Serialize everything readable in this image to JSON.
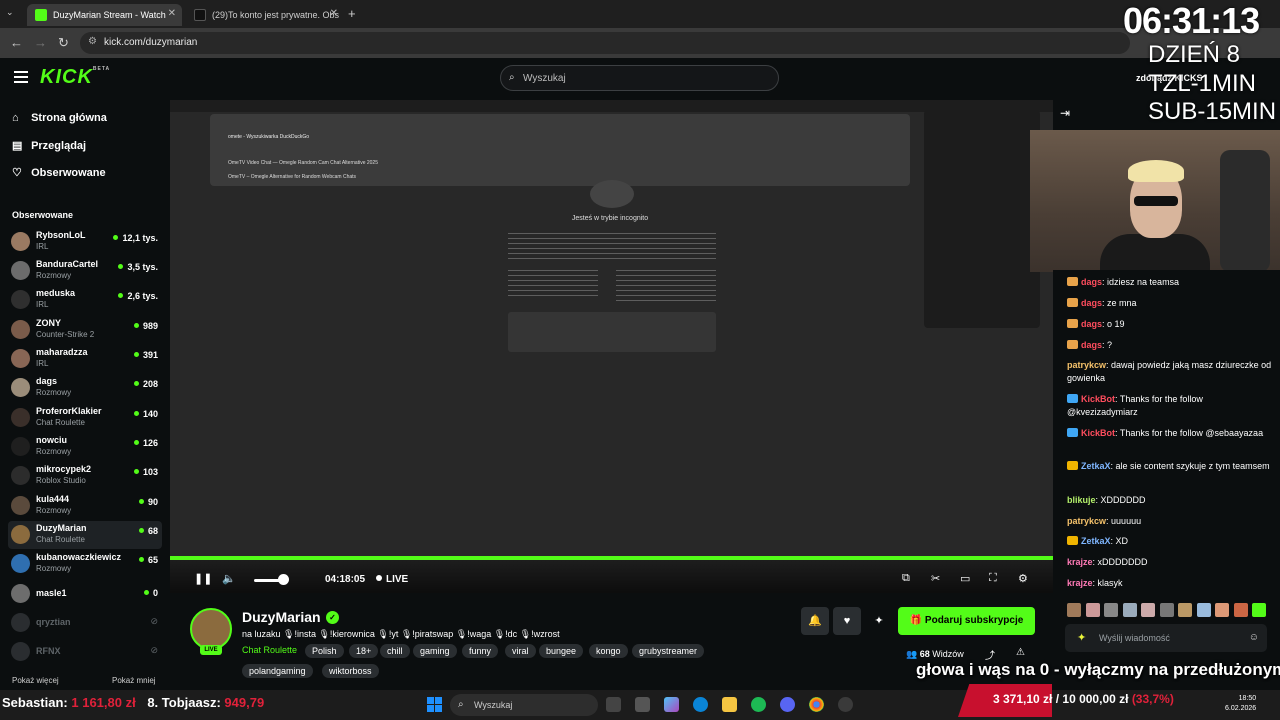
{
  "browser": {
    "tabs": [
      {
        "label": "DuzyMarian Stream - Watch",
        "active": true
      },
      {
        "label": "(29)To konto jest prywatne. Obs",
        "active": false
      }
    ],
    "url": "kick.com/duzymarian"
  },
  "header": {
    "search_placeholder": "Wyszukaj"
  },
  "sidebar": {
    "nav": [
      {
        "label": "Strona główna",
        "icon": "home-icon"
      },
      {
        "label": "Przeglądaj",
        "icon": "browse-icon"
      },
      {
        "label": "Obserwowane",
        "icon": "heart-icon"
      }
    ],
    "followed_title": "Obserwowane",
    "channels": [
      {
        "name": "RybsonLoL",
        "category": "IRL",
        "viewers": "12,1 tys."
      },
      {
        "name": "BanduraCartel",
        "category": "Rozmowy",
        "viewers": "3,5 tys."
      },
      {
        "name": "meduska",
        "category": "IRL",
        "viewers": "2,6 tys."
      },
      {
        "name": "ZONY",
        "category": "Counter-Strike 2",
        "viewers": "989"
      },
      {
        "name": "maharadzza",
        "category": "IRL",
        "viewers": "391"
      },
      {
        "name": "dags",
        "category": "Rozmowy",
        "viewers": "208"
      },
      {
        "name": "ProferorKlakier",
        "category": "Chat Roulette",
        "viewers": "140"
      },
      {
        "name": "nowciu",
        "category": "Rozmowy",
        "viewers": "126"
      },
      {
        "name": "mikrocypek2",
        "category": "Roblox Studio",
        "viewers": "103"
      },
      {
        "name": "kula444",
        "category": "Rozmowy",
        "viewers": "90"
      },
      {
        "name": "DuzyMarian",
        "category": "Chat Roulette",
        "viewers": "68"
      },
      {
        "name": "kubanowaczkiewicz",
        "category": "Rozmowy",
        "viewers": "65"
      },
      {
        "name": "masle1",
        "category": "",
        "viewers": "0"
      },
      {
        "name": "qryztian",
        "category": "",
        "viewers": ""
      },
      {
        "name": "RFNX",
        "category": "",
        "viewers": ""
      }
    ],
    "show_more": "Pokaż więcej",
    "show_less": "Pokaż mniej"
  },
  "player": {
    "time": "04:18:05",
    "live_label": "LIVE",
    "volume_fraction": 0.75,
    "inner_screen": {
      "incognito_title": "Jesteś w trybie incognito",
      "dropdown_items": [
        "omete - Wyszukiwarka DuckDuckGo",
        "OmeTV Video Chat — Omegle Random Cam Chat Alternative 2025",
        "OmeTV – Omegle Alternative for Random Webcam Chats"
      ]
    }
  },
  "overlay": {
    "clock": "06:31:13",
    "day": "DZIEŃ 8",
    "tzl": "TZL-1MIN",
    "sub": "SUB-15MIN",
    "kick_label": "zdobądź KICKS"
  },
  "chat": {
    "messages": [
      {
        "user": "dags",
        "text": "idziesz na teamsa",
        "color": "#ff4d5e",
        "badge": "#e8a34a"
      },
      {
        "user": "dags",
        "text": "ze mna",
        "color": "#ff4d5e",
        "badge": "#e8a34a"
      },
      {
        "user": "dags",
        "text": "o 19",
        "color": "#ff4d5e",
        "badge": "#e8a34a"
      },
      {
        "user": "dags",
        "text": "?",
        "color": "#ff4d5e",
        "badge": "#e8a34a"
      },
      {
        "user": "patrykcw",
        "text": "dawaj powiedz jaką masz dziureczke od gowienka",
        "color": "#f5c26b",
        "badge": ""
      },
      {
        "user": "KickBot",
        "text": "Thanks for the follow @kvezizadymiarz",
        "color": "#ff4d5e",
        "badge": "#3fa7f5"
      },
      {
        "user": "KickBot",
        "text": "Thanks for the follow @sebaayazaa",
        "color": "#ff4d5e",
        "badge": "#3fa7f5"
      },
      {
        "user": "ZetkaX",
        "text": "ale sie content szykuje z tym teamsem",
        "color": "#7fb6ff",
        "badge": "#f0b400"
      },
      {
        "user": "blikuje",
        "text": "XDDDDDD",
        "color": "#b4f06b",
        "badge": ""
      },
      {
        "user": "patrykcw",
        "text": "uuuuuu",
        "color": "#f5c26b",
        "badge": ""
      },
      {
        "user": "ZetkaX",
        "text": "XD",
        "color": "#7fb6ff",
        "badge": "#f0b400"
      },
      {
        "user": "krajze",
        "text": "xDDDDDDD",
        "color": "#ff7ab6",
        "badge": ""
      },
      {
        "user": "krajze",
        "text": "klasyk",
        "color": "#ff7ab6",
        "badge": ""
      }
    ],
    "input_placeholder": "Wyślij wiadomość"
  },
  "stream": {
    "name": "DuzyMarian",
    "title": "na luzaku 🎙!insta 🎙!kierownica 🎙!yt 🎙!piratswap 🎙!waga 🎙!dc 🎙!wzrost",
    "category": "Chat Roulette",
    "live_label": "LIVE",
    "tags": [
      "Polish",
      "18+",
      "chill",
      "gaming",
      "funny",
      "viral",
      "bungee",
      "kongo",
      "grubystreamer",
      "polandgaming",
      "wiktorboss"
    ],
    "subscribe_label": "Podaruj subskrypcje",
    "viewers": "68",
    "viewers_suffix": "Widzów",
    "ticker": "głowa i wąs na 0 - wyłączmy na przedłużonym"
  },
  "taskbar": {
    "left_text_1": "Sebastian:",
    "left_amount_1": "1 161,80 zł",
    "left_text_2": "8. Tobjaasz:",
    "left_amount_2": "949,79",
    "search_placeholder": "Wyszukaj",
    "goal_current": "3 371,10 zł",
    "goal_target": "10 000,00 zł",
    "goal_percent": "(33,7%)",
    "time": "18:50",
    "date": "6.02.2026"
  },
  "colors": {
    "brand_green": "#53fc18",
    "background": "#0b0e0f"
  }
}
